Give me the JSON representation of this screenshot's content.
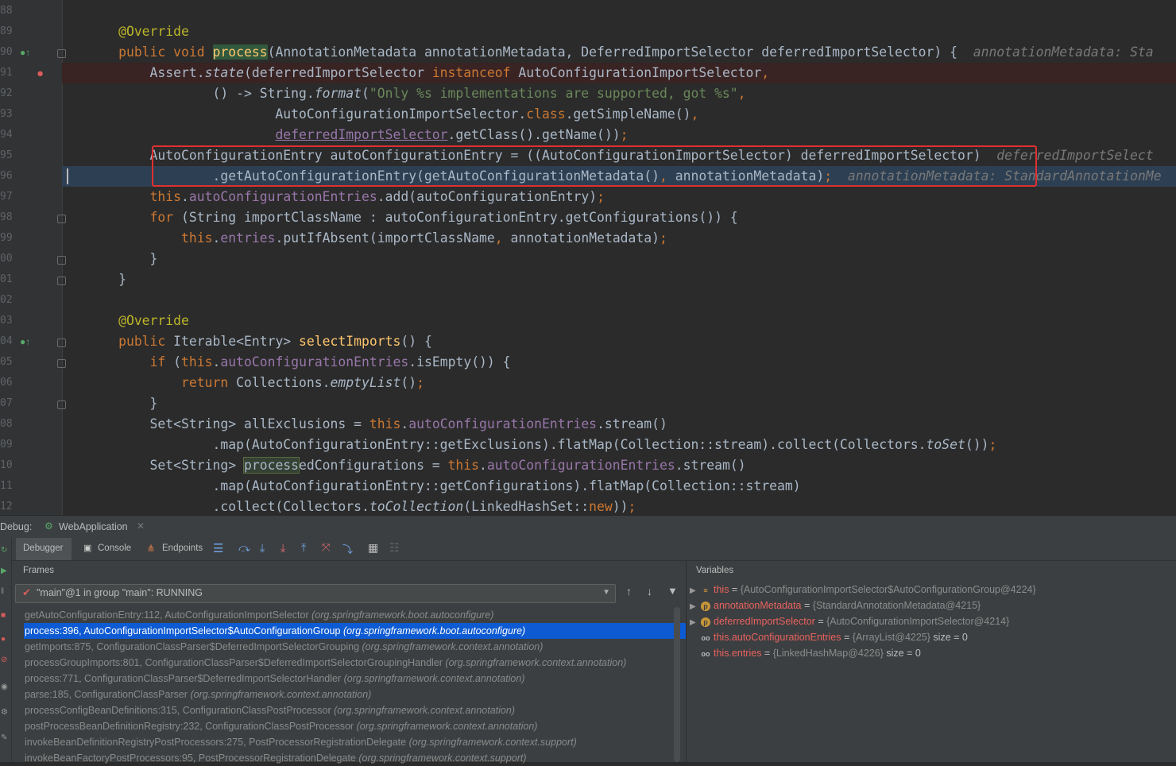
{
  "editor": {
    "line_numbers": [
      "88",
      "89",
      "90",
      "91",
      "92",
      "93",
      "94",
      "95",
      "96",
      "97",
      "98",
      "99",
      "00",
      "01",
      "02",
      "03",
      "04",
      "05",
      "06",
      "07",
      "08",
      "09",
      "10",
      "11",
      "12"
    ],
    "hints": {
      "l90": "annotationMetadata: Sta",
      "l95": "deferredImportSelect",
      "l96": "annotationMetadata: StandardAnnotationMe"
    }
  },
  "debug": {
    "label": "Debug:",
    "session_tab": "WebApplication",
    "tabs": [
      "Debugger",
      "Console",
      "Endpoints"
    ],
    "frames_title": "Frames",
    "thread": "\"main\"@1 in group \"main\": RUNNING",
    "variables_title": "Variables",
    "frames": [
      {
        "method": "getAutoConfigurationEntry:112, AutoConfigurationImportSelector",
        "pkg": "(org.springframework.boot.autoconfigure)"
      },
      {
        "method": "process:396, AutoConfigurationImportSelector$AutoConfigurationGroup",
        "pkg": "(org.springframework.boot.autoconfigure)"
      },
      {
        "method": "getImports:875, ConfigurationClassParser$DeferredImportSelectorGrouping",
        "pkg": "(org.springframework.context.annotation)"
      },
      {
        "method": "processGroupImports:801, ConfigurationClassParser$DeferredImportSelectorGroupingHandler",
        "pkg": "(org.springframework.context.annotation)"
      },
      {
        "method": "process:771, ConfigurationClassParser$DeferredImportSelectorHandler",
        "pkg": "(org.springframework.context.annotation)"
      },
      {
        "method": "parse:185, ConfigurationClassParser",
        "pkg": "(org.springframework.context.annotation)"
      },
      {
        "method": "processConfigBeanDefinitions:315, ConfigurationClassPostProcessor",
        "pkg": "(org.springframework.context.annotation)"
      },
      {
        "method": "postProcessBeanDefinitionRegistry:232, ConfigurationClassPostProcessor",
        "pkg": "(org.springframework.context.annotation)"
      },
      {
        "method": "invokeBeanDefinitionRegistryPostProcessors:275, PostProcessorRegistrationDelegate",
        "pkg": "(org.springframework.context.support)"
      },
      {
        "method": "invokeBeanFactoryPostProcessors:95, PostProcessorRegistrationDelegate",
        "pkg": "(org.springframework.context.support)"
      }
    ],
    "variables": [
      {
        "name": "this",
        "eq": " = ",
        "value": "{AutoConfigurationImportSelector$AutoConfigurationGroup@4224}",
        "size": ""
      },
      {
        "name": "annotationMetadata",
        "eq": " = ",
        "value": "{StandardAnnotationMetadata@4215}",
        "size": ""
      },
      {
        "name": "deferredImportSelector",
        "eq": " = ",
        "value": "{AutoConfigurationImportSelector@4214}",
        "size": ""
      },
      {
        "name": "this.autoConfigurationEntries",
        "eq": " = ",
        "value": "{ArrayList@4225}",
        "size": " size = 0"
      },
      {
        "name": "this.entries",
        "eq": " = ",
        "value": "{LinkedHashMap@4226}",
        "size": " size = 0"
      }
    ]
  }
}
